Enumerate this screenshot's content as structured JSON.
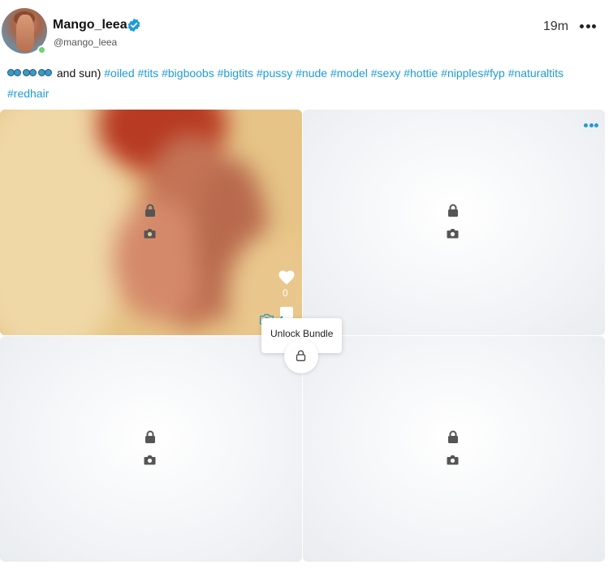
{
  "post": {
    "display_name": "Mango_leea",
    "username": "@mango_leea",
    "timestamp": "19m",
    "verified": true,
    "online": true
  },
  "caption": {
    "text": "and sun)",
    "emoji_count": 3,
    "hashtags": [
      "#oiled",
      "#tits",
      "#bigboobs",
      "#bigtits",
      "#pussy",
      "#nude",
      "#model",
      "#sexy",
      "#hottie",
      "#nipples",
      "#fyp",
      "#naturaltits",
      "#redhair"
    ]
  },
  "media": {
    "likes": "0",
    "media_count": "4",
    "unlock_label": "Unlock Bundle"
  },
  "icons": {
    "verified": "verified-badge-icon",
    "more": "more-options-icon",
    "lock": "lock-icon",
    "camera": "camera-icon",
    "like": "heart-icon",
    "bookmark": "bookmark-icon"
  },
  "colors": {
    "accent": "#1e9bd7",
    "online": "#6fd36f",
    "text": "#111111"
  }
}
